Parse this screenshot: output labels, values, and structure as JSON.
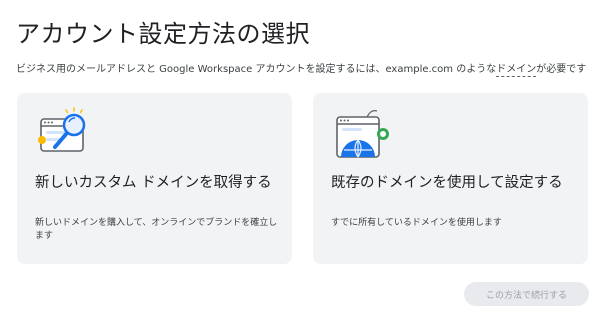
{
  "page": {
    "title": "アカウント設定方法の選択",
    "subtitle_pre": "ビジネス用のメールアドレスと Google Workspace アカウントを設定するには、example.com のような",
    "subtitle_term": "ドメイン",
    "subtitle_post": "が必要です"
  },
  "options": [
    {
      "icon": "domain-search-icon",
      "title": "新しいカスタム ドメインを取得する",
      "description": "新しいドメインを購入して、オンラインでブランドを確立します"
    },
    {
      "icon": "existing-domain-globe-icon",
      "title": "既存のドメインを使用して設定する",
      "description": "すでに所有しているドメインを使用します"
    }
  ],
  "footer": {
    "continue_label": "この方法で続行する"
  },
  "colors": {
    "card_background": "#f1f3f4",
    "icon_blue": "#1a73e8",
    "icon_green": "#34a853",
    "icon_yellow": "#fbbc04",
    "button_disabled_bg": "#e8eaed",
    "button_disabled_text": "#9aa0a6"
  }
}
